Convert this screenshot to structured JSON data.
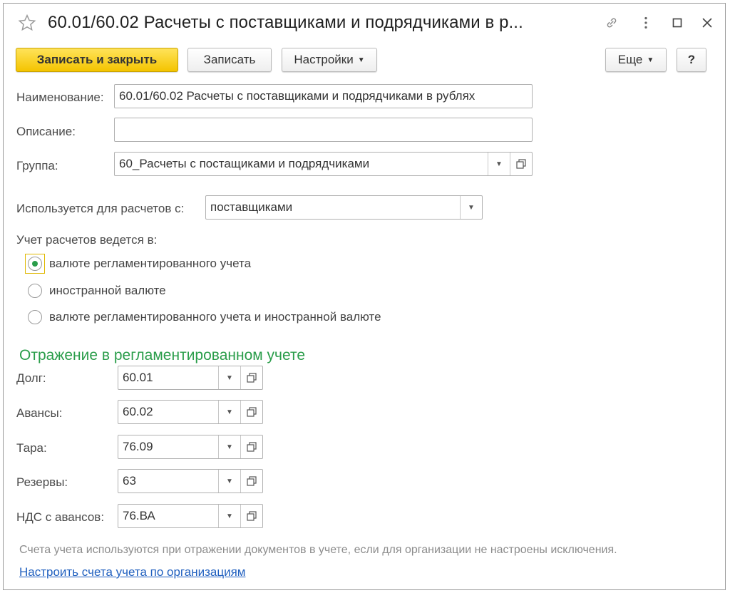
{
  "window": {
    "title": "60.01/60.02 Расчеты с поставщиками и подрядчиками в р..."
  },
  "toolbar": {
    "save_close_label": "Записать и закрыть",
    "save_label": "Записать",
    "settings_label": "Настройки",
    "more_label": "Еще",
    "help_label": "?"
  },
  "form": {
    "name_label": "Наименование:",
    "name_value": "60.01/60.02 Расчеты с поставщиками и подрядчиками в рублях",
    "description_label": "Описание:",
    "description_value": "",
    "group_label": "Группа:",
    "group_value": "60_Расчеты с постащиками и подрядчиками",
    "used_for_label": "Используется для расчетов с:",
    "used_for_value": "поставщиками",
    "accounting_label": "Учет расчетов ведется в:",
    "radio_options": [
      {
        "label": "валюте регламентированного учета",
        "selected": true
      },
      {
        "label": "иностранной валюте",
        "selected": false
      },
      {
        "label": "валюте регламентированного учета и иностранной валюте",
        "selected": false
      }
    ]
  },
  "reflection": {
    "section_title": "Отражение в регламентированном учете",
    "rows": [
      {
        "label": "Долг:",
        "value": "60.01"
      },
      {
        "label": "Авансы:",
        "value": "60.02"
      },
      {
        "label": "Тара:",
        "value": "76.09"
      },
      {
        "label": "Резервы:",
        "value": "63"
      },
      {
        "label": "НДС с авансов:",
        "value": "76.ВА"
      }
    ]
  },
  "footer": {
    "note": "Счета учета используются при отражении документов в учете, если для организации не настроены исключения.",
    "link": "Настроить счета учета по организациям"
  },
  "icons": {
    "favorite": "star-icon",
    "link": "link-icon",
    "menu": "kebab-menu-icon",
    "maximize": "maximize-icon",
    "close": "close-icon",
    "open": "open-form-icon",
    "dropdown": "chevron-down-icon"
  },
  "colors": {
    "primary_button": "#f4c400",
    "section_title": "#2a9d4a",
    "link": "#1f5fbf",
    "radio_selected": "#2a9d4a"
  }
}
